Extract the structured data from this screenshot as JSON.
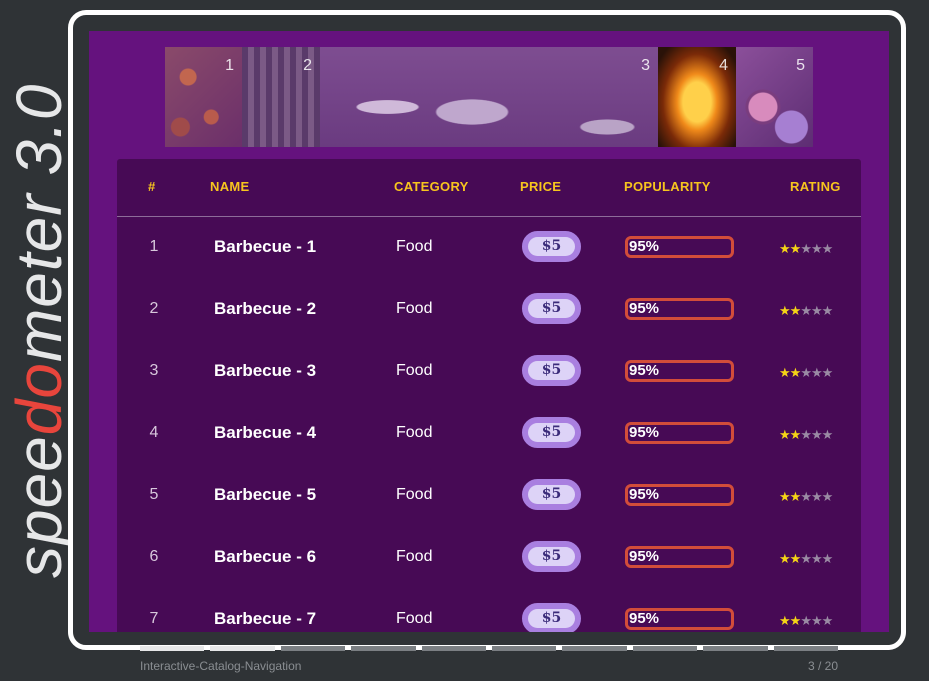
{
  "brand": {
    "prefix": "spee",
    "accent": "do",
    "suffix": "meter",
    "version": "3.0"
  },
  "banner": {
    "tiles": [
      "1",
      "2",
      "3",
      "4",
      "5"
    ]
  },
  "table": {
    "headers": [
      "#",
      "NAME",
      "CATEGORY",
      "PRICE",
      "POPULARITY",
      "RATING"
    ],
    "rows": [
      {
        "idx": "1",
        "name": "Barbecue - 1",
        "category": "Food",
        "price": "$5",
        "popularity": "95%",
        "popularity_value": 0.95,
        "rating": 2
      },
      {
        "idx": "2",
        "name": "Barbecue - 2",
        "category": "Food",
        "price": "$5",
        "popularity": "95%",
        "popularity_value": 0.95,
        "rating": 2
      },
      {
        "idx": "3",
        "name": "Barbecue - 3",
        "category": "Food",
        "price": "$5",
        "popularity": "95%",
        "popularity_value": 0.95,
        "rating": 2
      },
      {
        "idx": "4",
        "name": "Barbecue - 4",
        "category": "Food",
        "price": "$5",
        "popularity": "95%",
        "popularity_value": 0.95,
        "rating": 2
      },
      {
        "idx": "5",
        "name": "Barbecue - 5",
        "category": "Food",
        "price": "$5",
        "popularity": "95%",
        "popularity_value": 0.95,
        "rating": 2
      },
      {
        "idx": "6",
        "name": "Barbecue - 6",
        "category": "Food",
        "price": "$5",
        "popularity": "95%",
        "popularity_value": 0.95,
        "rating": 2
      },
      {
        "idx": "7",
        "name": "Barbecue - 7",
        "category": "Food",
        "price": "$5",
        "popularity": "95%",
        "popularity_value": 0.95,
        "rating": 2
      }
    ],
    "max_rating": 5
  },
  "footer": {
    "title": "Interactive-Catalog-Navigation",
    "page": "3 / 20",
    "progress_segments": 10,
    "progress_active": 2
  },
  "colors": {
    "accent": "#f7c51e",
    "brand_accent": "#e8453c",
    "stage_bg": "#65127e",
    "table_bg": "#470a55",
    "popularity_border": "#d24d3a",
    "price_pill": "#a97fe0"
  }
}
